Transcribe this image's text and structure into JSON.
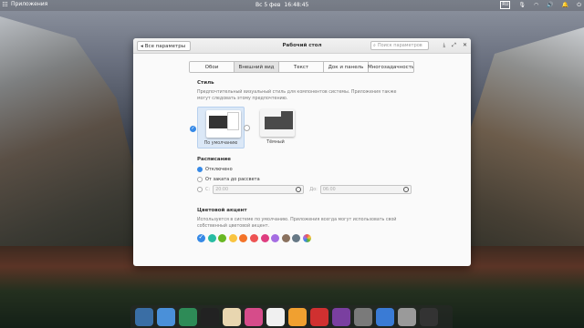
{
  "top_panel": {
    "apps_label": "Приложения",
    "date": "Вс  5 фев",
    "time": "16:48:45",
    "keyboard_layout": "RU"
  },
  "window": {
    "back_label": "Все параметры",
    "title": "Рабочий стол",
    "search_placeholder": "Поиск параметров",
    "tabs": [
      {
        "label": "Обои",
        "active": false
      },
      {
        "label": "Внешний вид",
        "active": true
      },
      {
        "label": "Текст",
        "active": false
      },
      {
        "label": "Док и панель",
        "active": false
      },
      {
        "label": "Многозадачность",
        "active": false
      }
    ],
    "style": {
      "heading": "Стиль",
      "description": "Предпочтительный визуальный стиль для компонентов системы. Приложения также могут следовать этому предпочтению.",
      "options": [
        {
          "label": "По умолчанию",
          "selected": true
        },
        {
          "label": "Тёмный",
          "selected": false
        }
      ]
    },
    "schedule": {
      "heading": "Расписание",
      "options": [
        {
          "label": "Отключено",
          "selected": true
        },
        {
          "label": "От заката до рассвета",
          "selected": false
        }
      ],
      "from_label": "С:",
      "from_value": "20:00",
      "to_label": "До:",
      "to_value": "06:00"
    },
    "accent": {
      "heading": "Цветовой акцент",
      "description": "Используется в системе по умолчанию. Приложения всегда могут использовать свой собственный цветовой акцент.",
      "colors": [
        {
          "name": "blueberry",
          "hex": "#3689e6",
          "selected": true
        },
        {
          "name": "mint",
          "hex": "#28bca3",
          "selected": false
        },
        {
          "name": "lime",
          "hex": "#68b723",
          "selected": false
        },
        {
          "name": "banana",
          "hex": "#f9c440",
          "selected": false
        },
        {
          "name": "orange",
          "hex": "#f37329",
          "selected": false
        },
        {
          "name": "strawberry",
          "hex": "#ed5353",
          "selected": false
        },
        {
          "name": "bubblegum",
          "hex": "#de3e80",
          "selected": false
        },
        {
          "name": "grape",
          "hex": "#a56de2",
          "selected": false
        },
        {
          "name": "cocoa",
          "hex": "#8a715e",
          "selected": false
        },
        {
          "name": "slate",
          "hex": "#667885",
          "selected": false
        },
        {
          "name": "auto",
          "hex": "conic",
          "selected": false
        }
      ]
    }
  },
  "dock": {
    "icons": [
      {
        "name": "multitasking-icon",
        "color": "#3a6ea5"
      },
      {
        "name": "files-icon",
        "color": "#4a90d9"
      },
      {
        "name": "browser-icon",
        "color": "#2e8b57"
      },
      {
        "name": "terminal-icon",
        "color": "#222222"
      },
      {
        "name": "mail-icon",
        "color": "#e8d6b0"
      },
      {
        "name": "tasks-icon",
        "color": "#d64c8a"
      },
      {
        "name": "calendar-icon",
        "color": "#f0f0f0"
      },
      {
        "name": "music-icon",
        "color": "#f0a030"
      },
      {
        "name": "videos-icon",
        "color": "#d03030"
      },
      {
        "name": "photos-icon",
        "color": "#7a3fa0"
      },
      {
        "name": "settings-icon",
        "color": "#7a7a7a"
      },
      {
        "name": "appcenter-icon",
        "color": "#3a7bd5"
      },
      {
        "name": "trash-icon",
        "color": "#9a9a9a"
      },
      {
        "name": "system-icon",
        "color": "#333333"
      }
    ]
  }
}
